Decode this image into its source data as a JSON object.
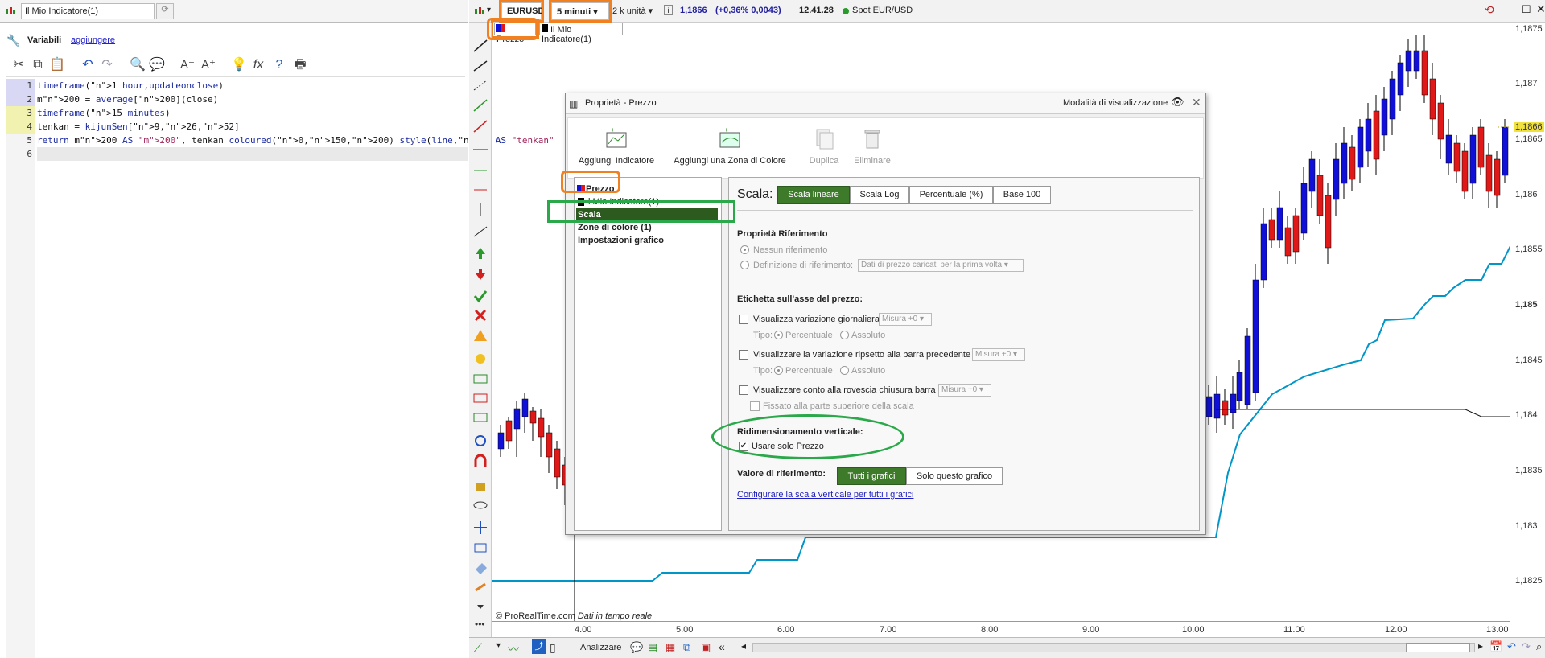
{
  "editor": {
    "name": "Il Mio Indicatore(1)",
    "variables_label": "Variabili",
    "add_link": "aggiungere",
    "lines": [
      {
        "no": "1",
        "hl": "hl"
      },
      {
        "no": "2",
        "hl": "hl"
      },
      {
        "no": "3",
        "hl": "hy"
      },
      {
        "no": "4",
        "hl": "hy"
      },
      {
        "no": "5",
        "hl": ""
      },
      {
        "no": "6",
        "hl": ""
      }
    ],
    "code": {
      "l1": "timeframe(1 hour,updateonclose)",
      "l2": "m200 = average[200](close)",
      "l3": "timeframe(15 minutes)",
      "l4": "tenkan = kijunSen[9,26,52]",
      "l5": "return m200 AS \"m200\", tenkan coloured(0,150,200) style(line,2) AS \"tenkan\"",
      "l6": ""
    }
  },
  "toolbar": {
    "symbol": "EURUSD",
    "timeframe": "5 minuti",
    "units": "2 k unità",
    "price": "1,1866",
    "change": "(+0,36% 0,0043)",
    "time": "12.41.28",
    "instrument": "Spot EUR/USD"
  },
  "legend": {
    "price_tag": "Prezzo",
    "indicator_tag": "Il Mio Indicatore(1)"
  },
  "price_axis": {
    "labels": [
      "1,1875",
      "1,187",
      "1,1866",
      "1,1865",
      "1,186",
      "1,1855",
      "1,185",
      "1,1845",
      "1,184",
      "1,1835",
      "1,183",
      "1,1825"
    ],
    "current": "1,1866"
  },
  "time_axis": {
    "labels": [
      "4.00",
      "5.00",
      "6.00",
      "7.00",
      "8.00",
      "9.00",
      "10.00",
      "11.00",
      "12.00",
      "13.00"
    ]
  },
  "watermark": {
    "brand": "© ProRealTime.com",
    "realtime": "Dati in tempo reale"
  },
  "bottom": {
    "analyze": "Analizzare"
  },
  "dialog": {
    "title": "Proprietà - Prezzo",
    "mode": "Modalità di visualizzazione",
    "tools": {
      "add_indicator": "Aggiungi Indicatore",
      "add_zone": "Aggiungi una Zona di Colore",
      "duplicate": "Duplica",
      "delete": "Eliminare"
    },
    "list": {
      "prezzo": "Prezzo",
      "indicator": "Il Mio Indicatore(1)",
      "scala": "Scala",
      "zones": "Zone di colore (1)",
      "chart_settings": "Impostazioni grafico"
    },
    "panel": {
      "scale_label": "Scala:",
      "seg_linear": "Scala lineare",
      "seg_log": "Scala Log",
      "seg_percent": "Percentuale (%)",
      "seg_base": "Base 100",
      "ref_title": "Proprietà Riferimento",
      "ref_none": "Nessun riferimento",
      "ref_def": "Definizione di riferimento:",
      "ref_dd": "Dati di prezzo caricati per la prima volta",
      "label_title": "Etichetta sull'asse del prezzo:",
      "daily_var": "Visualizza variazione giornaliera",
      "measure": "Misura +0",
      "type_label": "Tipo:",
      "type_percent": "Percentuale",
      "type_absolute": "Assoluto",
      "prev_bar_var": "Visualizzare la variazione ripsetto alla barra precedente",
      "countdown": "Visualizzare conto alla rovescia chiusura barra",
      "fixed_top": "Fissato alla parte superiore della scala",
      "vertical_title": "Ridimensionamento verticale:",
      "use_price_only": "Usare solo Prezzo",
      "ref_value": "Valore di riferimento:",
      "all_charts": "Tutti i grafici",
      "this_chart": "Solo questo grafico",
      "configure_link": "Configurare la scala verticale per tutti i grafici"
    }
  },
  "colors": {
    "bull": "#1010d8",
    "bear": "#e01818",
    "tenkan": "#0096c8",
    "m200": "#111111",
    "accent_green": "#3d7a2a",
    "highlight_orange": "#f08020",
    "highlight_green": "#2aa84a"
  }
}
